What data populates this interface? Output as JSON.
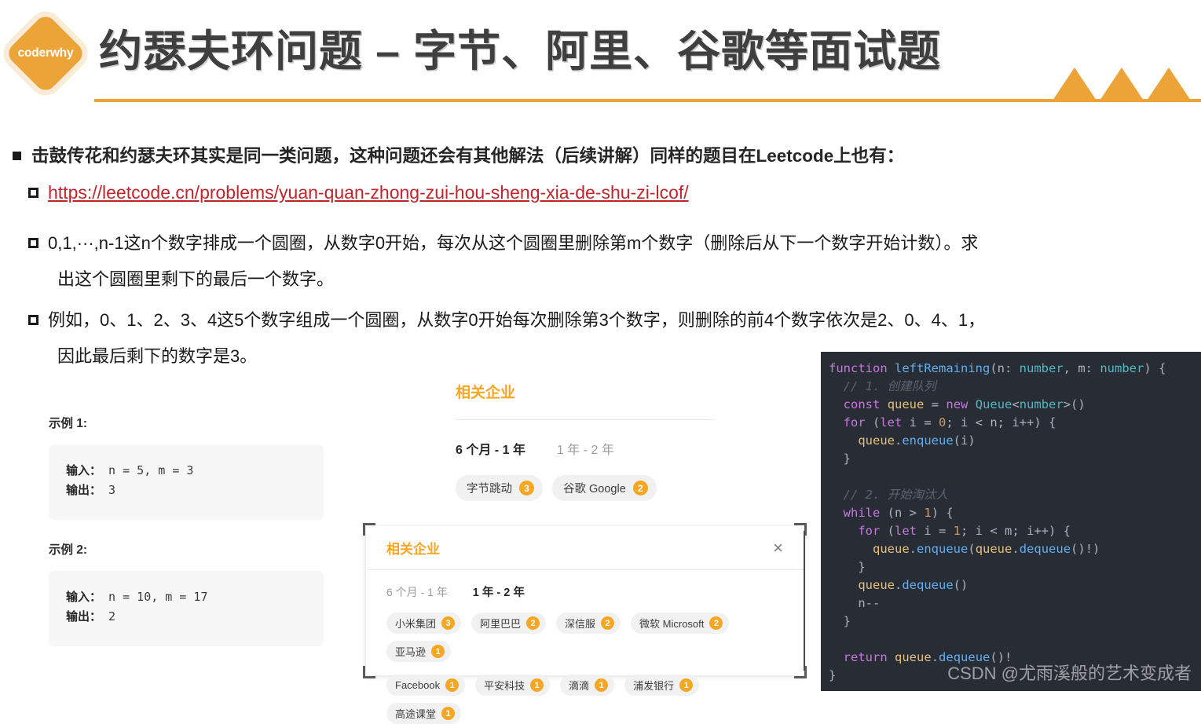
{
  "header": {
    "logo_text": "coderwhy",
    "title": "约瑟夫环问题 – 字节、阿里、谷歌等面试题",
    "accent_color": "#ECA338"
  },
  "bullets": {
    "level1": "击鼓传花和约瑟夫环其实是同一类问题，这种问题还会有其他解法（后续讲解）同样的题目在Leetcode上也有：",
    "link": "https://leetcode.cn/problems/yuan-quan-zhong-zui-hou-sheng-xia-de-shu-zi-lcof/",
    "link_color": "#C0252C",
    "para1_line1": "0,1,···,n-1这n个数字排成一个圆圈，从数字0开始，每次从这个圆圈里删除第m个数字（删除后从下一个数字开始计数）。求",
    "para1_line2": "出这个圆圈里剩下的最后一个数字。",
    "para2_line1": "例如，0、1、2、3、4这5个数字组成一个圆圈，从数字0开始每次删除第3个数字，则删除的前4个数字依次是2、0、4、1，",
    "para2_line2": "因此最后剩下的数字是3。"
  },
  "examples": [
    {
      "title": "示例 1:",
      "input_label": "输入：",
      "input_value": " n = 5, m = 3",
      "output_label": "输出：",
      "output_value": " 3"
    },
    {
      "title": "示例 2:",
      "input_label": "输入：",
      "input_value": " n = 10, m = 17",
      "output_label": "输出：",
      "output_value": " 2"
    }
  ],
  "company_panel": {
    "title": "相关企业",
    "tabs": [
      {
        "label": "6 个月 - 1 年",
        "active": true
      },
      {
        "label": "1 年 - 2 年",
        "active": false
      }
    ],
    "tags": [
      {
        "name": "字节跳动",
        "count": "3"
      },
      {
        "name": "谷歌 Google",
        "count": "2"
      }
    ]
  },
  "company_modal": {
    "title": "相关企业",
    "close_icon": "×",
    "tabs": [
      {
        "label": "6 个月 - 1 年",
        "active": false
      },
      {
        "label": "1 年 - 2 年",
        "active": true
      }
    ],
    "tags_row1": [
      {
        "name": "小米集团",
        "count": "3"
      },
      {
        "name": "阿里巴巴",
        "count": "2"
      },
      {
        "name": "深信服",
        "count": "2"
      },
      {
        "name": "微软 Microsoft",
        "count": "2"
      },
      {
        "name": "亚马逊",
        "count": "1"
      }
    ],
    "tags_row2": [
      {
        "name": "Facebook",
        "count": "1"
      },
      {
        "name": "平安科技",
        "count": "1"
      },
      {
        "name": "滴滴",
        "count": "1"
      },
      {
        "name": "浦发银行",
        "count": "1"
      },
      {
        "name": "高途课堂",
        "count": "1"
      }
    ]
  },
  "code": {
    "language": "typescript",
    "lines": [
      "function leftRemaining(n: number, m: number) {",
      "  // 1. 创建队列",
      "  const queue = new Queue<number>()",
      "  for (let i = 0; i < n; i++) {",
      "    queue.enqueue(i)",
      "  }",
      "",
      "  // 2. 开始淘汰人",
      "  while (n > 1) {",
      "    for (let i = 1; i < m; i++) {",
      "      queue.enqueue(queue.dequeue()!)",
      "    }",
      "    queue.dequeue()",
      "    n--",
      "  }",
      "",
      "  return queue.dequeue()!",
      "}"
    ],
    "watermark": "CSDN @尤雨溪般的艺术变成者"
  }
}
